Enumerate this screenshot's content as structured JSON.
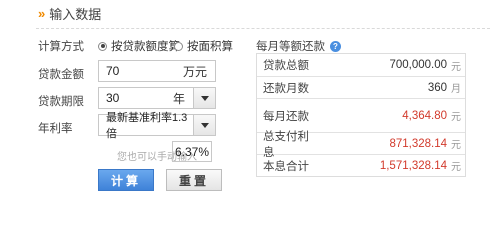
{
  "header": {
    "title": "输入数据"
  },
  "form": {
    "calc_method_label": "计算方式",
    "radio_by_amount": "按贷款额度算",
    "radio_by_area": "按面积算",
    "loan_amount_label": "贷款金额",
    "loan_amount_value": "70",
    "loan_amount_unit": "万元",
    "loan_term_label": "贷款期限",
    "loan_term_value": "30",
    "loan_term_unit": "年",
    "rate_label": "年利率",
    "rate_select": "最新基准利率1.3倍",
    "manual_hint": "您也可以手动输入",
    "manual_rate": "6.37%"
  },
  "buttons": {
    "calculate": "计算",
    "reset": "重置"
  },
  "results": {
    "title": "每月等额还款",
    "help_icon": "?",
    "unit_yuan": "元",
    "unit_month": "月",
    "rows": [
      {
        "label": "贷款总额",
        "value": "700,000.00"
      },
      {
        "label": "还款月数",
        "value": "360"
      },
      {
        "label": "每月还款",
        "value": "4,364.80"
      },
      {
        "label": "总支付利息",
        "value": "871,328.14"
      },
      {
        "label": "本息合计",
        "value": "1,571,328.14"
      }
    ]
  },
  "colors": {
    "accent_orange": "#f08a00",
    "primary_blue": "#3f82d8",
    "result_red": "#d23a2c"
  }
}
